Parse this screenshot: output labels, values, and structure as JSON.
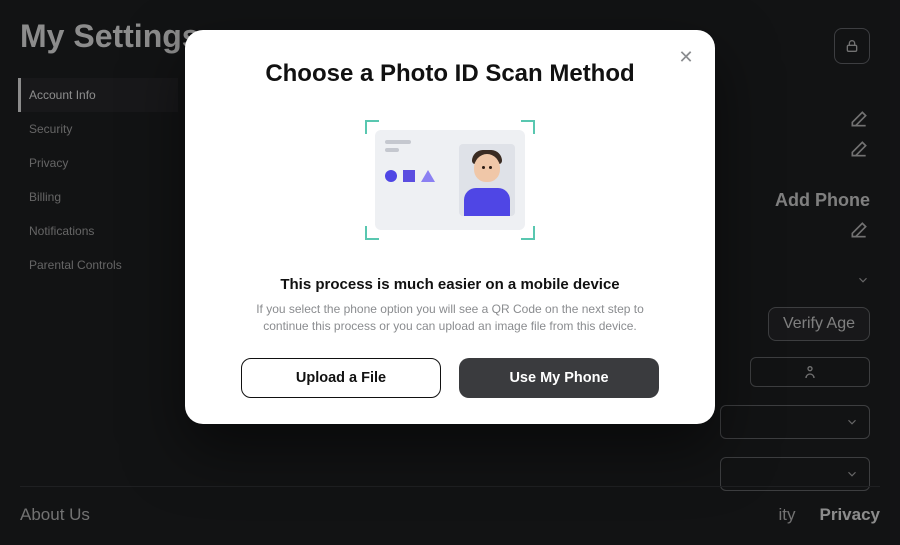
{
  "page": {
    "title": "My Settings"
  },
  "sidebar": {
    "items": [
      {
        "label": "Account Info",
        "active": true
      },
      {
        "label": "Security"
      },
      {
        "label": "Privacy"
      },
      {
        "label": "Billing"
      },
      {
        "label": "Notifications"
      },
      {
        "label": "Parental Controls"
      }
    ]
  },
  "right_rail": {
    "add_phone_label": "Add Phone",
    "verify_age_label": "Verify Age"
  },
  "footer": {
    "about_label": "About Us",
    "right_partial": "ity",
    "privacy_label": "Privacy"
  },
  "modal": {
    "title": "Choose a Photo ID Scan Method",
    "hint_strong": "This process is much easier on a mobile device",
    "hint_sub": "If you select the phone option you will see a QR Code on the next step to continue this process or you can upload an image file from this device.",
    "upload_label": "Upload a File",
    "phone_label": "Use My Phone"
  }
}
